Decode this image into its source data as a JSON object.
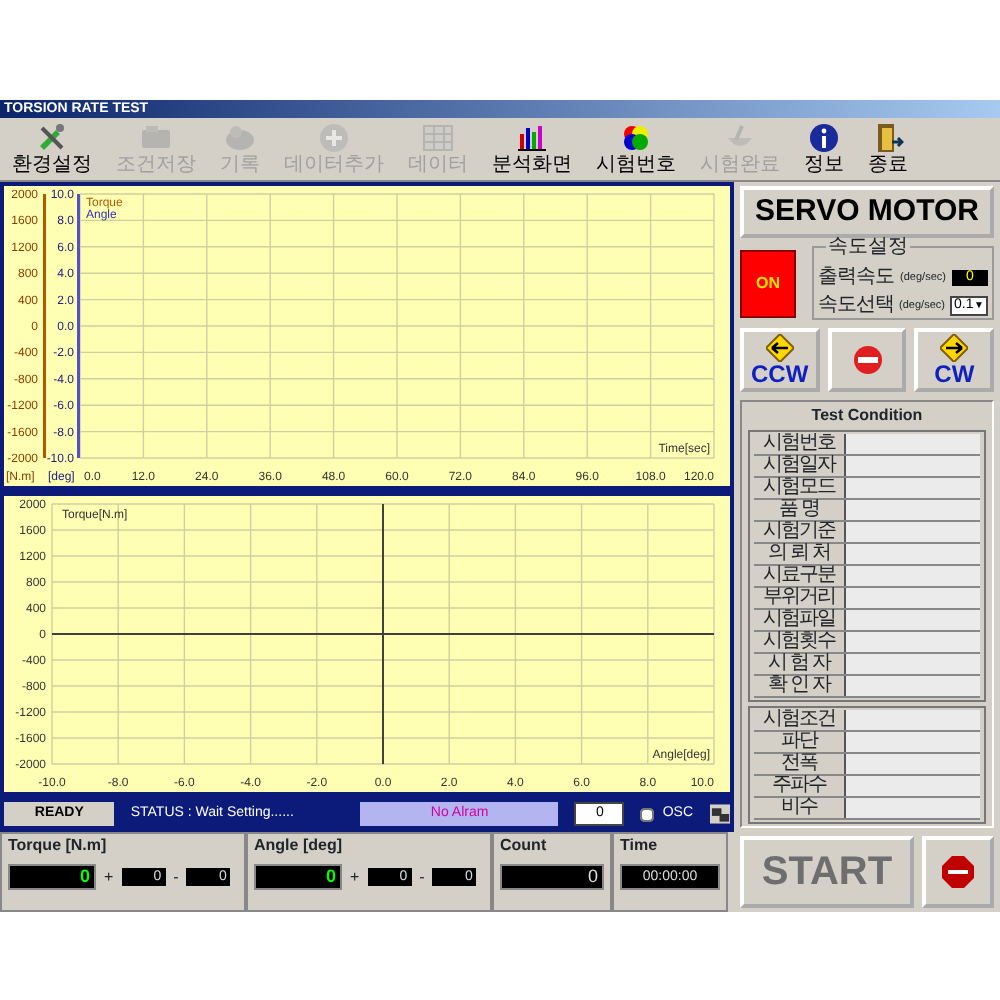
{
  "window": {
    "title": "TORSION RATE TEST"
  },
  "toolbar": [
    {
      "label": "환경설정",
      "disabled": false
    },
    {
      "label": "조건저장",
      "disabled": true
    },
    {
      "label": "기록",
      "disabled": true
    },
    {
      "label": "데이터추가",
      "disabled": true
    },
    {
      "label": "데이터",
      "disabled": true
    },
    {
      "label": "분석화면",
      "disabled": false
    },
    {
      "label": "시험번호",
      "disabled": false
    },
    {
      "label": "시험완료",
      "disabled": true
    },
    {
      "label": "정보",
      "disabled": false
    },
    {
      "label": "종료",
      "disabled": false
    }
  ],
  "time_chart": {
    "angle_axis": {
      "label": "[deg]",
      "color": "#5050d0",
      "ticks": [
        "10.0",
        "8.0",
        "6.0",
        "4.0",
        "2.0",
        "0.0",
        "-2.0",
        "-4.0",
        "-6.0",
        "-8.0",
        "-10.0"
      ]
    },
    "chart_data": {
      "type": "line",
      "xlabel": "Time[sec]",
      "ylabel": "[N.m]",
      "series": [
        {
          "name": "Torque",
          "color": "#b05a00",
          "values": [
            null,
            null,
            null,
            null,
            null,
            null,
            null,
            null,
            null,
            null,
            null
          ]
        },
        {
          "name": "Angle",
          "color": "#3030b0",
          "values": [
            null,
            null,
            null,
            null,
            null,
            null,
            null,
            null,
            null,
            null,
            null
          ]
        }
      ],
      "grid": true,
      "categories": [
        "0.0",
        "12.0",
        "24.0",
        "36.0",
        "48.0",
        "60.0",
        "72.0",
        "84.0",
        "96.0",
        "108.0",
        "120.0"
      ],
      "ylim": [
        -2000,
        2000
      ],
      "yticks": [
        2000,
        1600,
        1200,
        800,
        400,
        0,
        -400,
        -800,
        -1200,
        -1600,
        -2000
      ]
    }
  },
  "torque_angle_chart": {
    "chart_data": {
      "type": "line",
      "xlabel": "Angle[deg]",
      "ylabel": "Torque[N.m]",
      "grid": true,
      "xlim": [
        -10,
        10
      ],
      "ylim": [
        -2000,
        2000
      ],
      "xticks": [
        {
          "value": -10,
          "label": "-10.0"
        },
        {
          "value": -8,
          "label": "-8.0"
        },
        {
          "value": -6,
          "label": "-6.0"
        },
        {
          "value": -4,
          "label": "-4.0"
        },
        {
          "value": -2,
          "label": "-2.0"
        },
        {
          "value": 0,
          "label": "0.0"
        },
        {
          "value": 2,
          "label": "2.0"
        },
        {
          "value": 4,
          "label": "4.0"
        },
        {
          "value": 6,
          "label": "6.0"
        },
        {
          "value": 8,
          "label": "8.0"
        },
        {
          "value": 10,
          "label": "10.0"
        }
      ],
      "yticks": [
        2000,
        1600,
        1200,
        800,
        400,
        0,
        -400,
        -800,
        -1200,
        -1600,
        -2000
      ]
    }
  },
  "status_bar": {
    "state": "READY",
    "status": "STATUS : Wait Setting......",
    "alarm": "No Alram",
    "counter": "0",
    "osc": {
      "label": "OSC",
      "checked": false
    }
  },
  "readouts": [
    {
      "kind": "range",
      "title": "Torque [N.m]",
      "value": "0",
      "plus": "+",
      "max": "0",
      "minus": "-",
      "min": "0"
    },
    {
      "kind": "range",
      "title": "Angle [deg]",
      "value": "0",
      "plus": "+",
      "max": "0",
      "minus": "-",
      "min": "0"
    },
    {
      "kind": "plain",
      "title": "Count",
      "value": "0"
    },
    {
      "kind": "time",
      "title": "Time",
      "value": "00:00:00"
    }
  ],
  "servo": {
    "title": "SERVO MOTOR",
    "power": {
      "label": "ON",
      "on": true
    },
    "speed_group": {
      "title": "속도설정",
      "output_label": "출력속도",
      "output_unit": "(deg/sec)",
      "output_value": "0",
      "select_label": "속도선택",
      "select_unit": "(deg/sec)",
      "select_value": "0.1",
      "select_arrow": "▼"
    },
    "jog_buttons": [
      {
        "kind": "ccw",
        "label": "CCW"
      },
      {
        "kind": "stop"
      },
      {
        "kind": "cw",
        "label": "CW"
      }
    ]
  },
  "test_condition": {
    "title": "Test Condition",
    "groups": [
      [
        "시험번호",
        "시험일자",
        "시험모드",
        "품 명",
        "시험기준",
        "의 뢰 처",
        "시료구분",
        "부위거리",
        "시험파일",
        "시험횟수",
        "시 험 자",
        "확 인 자"
      ],
      [
        "시험조건",
        "파단",
        "전폭",
        "주파수",
        "비수"
      ]
    ]
  },
  "start": {
    "label": "START",
    "disabled": true
  }
}
